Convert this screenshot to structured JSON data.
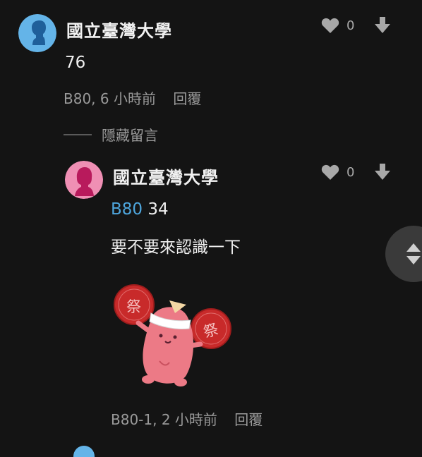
{
  "comment": {
    "author": "國立臺灣大學",
    "text": "76",
    "floor": "B80",
    "time": "6 小時前",
    "reply_label": "回覆",
    "like_count": "0",
    "avatar_color": "#64b4e8"
  },
  "hide_replies_label": "隱藏留言",
  "reply": {
    "author": "國立臺灣大學",
    "mention": "B80",
    "mention_text": "34",
    "text": "要不要來認識一下",
    "floor": "B80-1",
    "time": "2 小時前",
    "reply_label": "回覆",
    "like_count": "0",
    "avatar_color": "#ef8fb4",
    "sticker": {
      "name": "festival-blob-sticker",
      "fan_char": "祭"
    }
  },
  "icons": [
    "heart-icon",
    "download-arrow-icon",
    "scroll-arrows-icon"
  ]
}
